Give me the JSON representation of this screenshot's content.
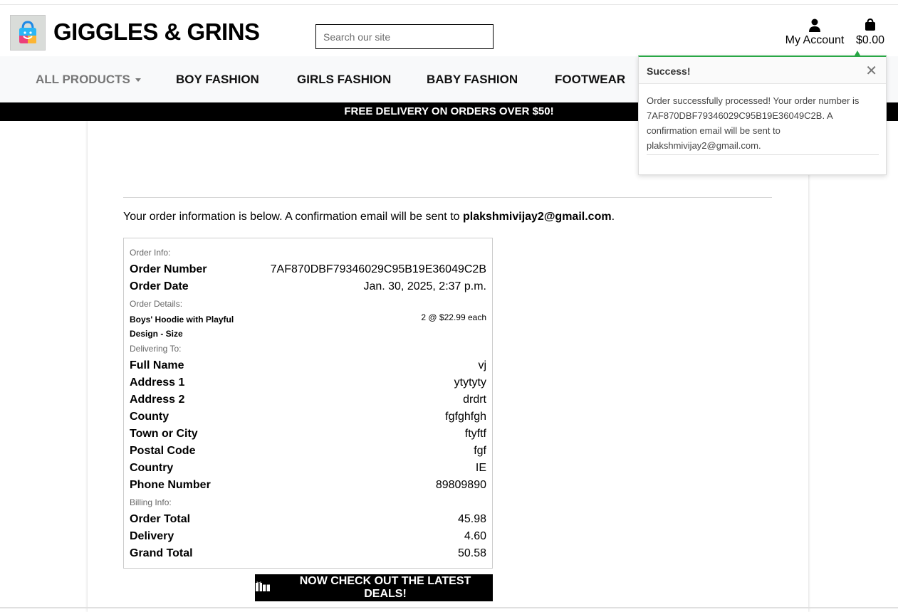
{
  "header": {
    "brand": "GIGGLES & GRINS",
    "search_placeholder": "Search our site",
    "account_label": "My Account",
    "cart_total": "$0.00"
  },
  "nav": {
    "items": [
      "ALL PRODUCTS",
      "BOY FASHION",
      "GIRLS FASHION",
      "BABY FASHION",
      "FOOTWEAR"
    ]
  },
  "banner": "FREE DELIVERY ON ORDERS OVER $50!",
  "intro": {
    "text": "Your order information is below. A confirmation email will be sent to ",
    "email": "plakshmivijay2@gmail.com",
    "end": "."
  },
  "order": {
    "info_heading": "Order Info:",
    "number_label": "Order Number",
    "number": "7AF870DBF79346029C95B19E36049C2B",
    "date_label": "Order Date",
    "date": "Jan. 30, 2025, 2:37 p.m.",
    "details_heading": "Order Details:",
    "item_name": "Boys' Hoodie with Playful Design - Size",
    "item_qty": "2 @ $22.99 each",
    "delivering_heading": "Delivering To:",
    "delivery": [
      {
        "label": "Full Name",
        "value": "vj"
      },
      {
        "label": "Address 1",
        "value": "ytytyty"
      },
      {
        "label": "Address 2",
        "value": "drdrt"
      },
      {
        "label": "County",
        "value": "fgfghfgh"
      },
      {
        "label": "Town or City",
        "value": "ftyftf"
      },
      {
        "label": "Postal Code",
        "value": "fgf"
      },
      {
        "label": "Country",
        "value": "IE"
      },
      {
        "label": "Phone Number",
        "value": "89809890"
      }
    ],
    "billing_heading": "Billing Info:",
    "billing": [
      {
        "label": "Order Total",
        "value": "45.98"
      },
      {
        "label": "Delivery",
        "value": "4.60"
      },
      {
        "label": "Grand Total",
        "value": "50.58"
      }
    ]
  },
  "deals_button": "NOW CHECK OUT THE LATEST DEALS!",
  "toast": {
    "title": "Success!",
    "message": "Order successfully processed! Your order number is 7AF870DBF79346029C95B19E36049C2B. A confirmation email will be sent to plakshmivijay2@gmail.com."
  },
  "colors": {
    "accent": "#28a745",
    "banner": "#000000",
    "nav_bg": "#f8f9fa"
  }
}
